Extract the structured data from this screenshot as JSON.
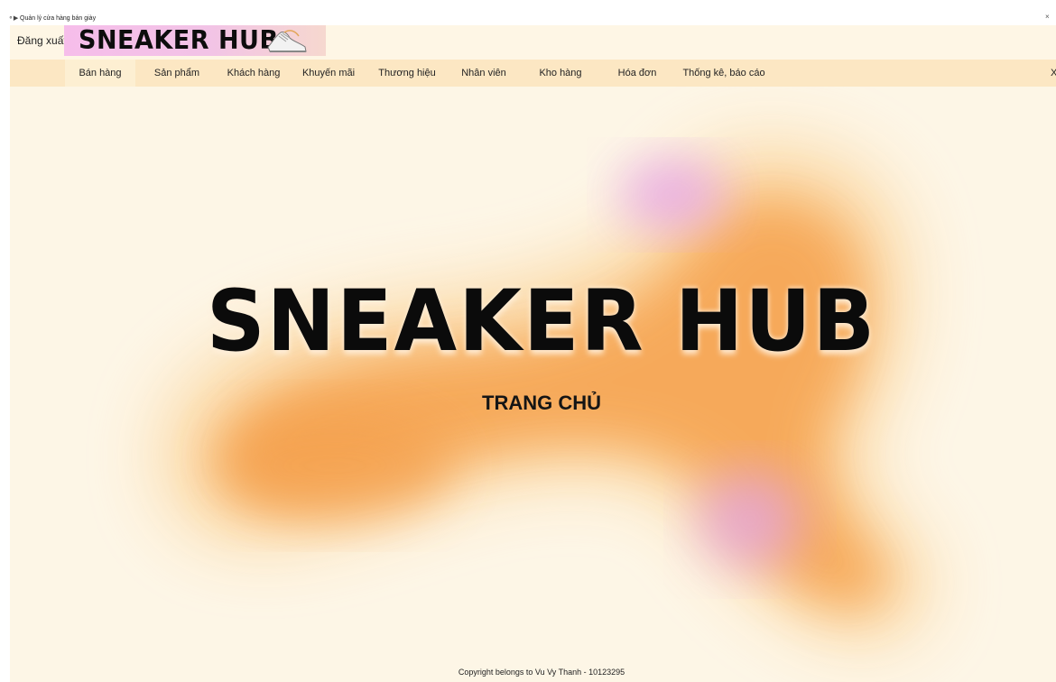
{
  "window": {
    "title": "Quản lý cửa hàng bán giày",
    "icon": "shoe-app-icon"
  },
  "header": {
    "logout_label": "Đăng xuất",
    "logo_text": "SNEAKER HUB",
    "logo_icon": "sneaker-icon"
  },
  "menu": {
    "items": [
      {
        "label": "Bán hàng",
        "active": true
      },
      {
        "label": "Sản phẩm"
      },
      {
        "label": "Khách hàng"
      },
      {
        "label": "Khuyến mãi"
      },
      {
        "label": "Thương hiệu"
      },
      {
        "label": "Nhân viên"
      },
      {
        "label": "Kho hàng"
      },
      {
        "label": "Hóa đơn"
      },
      {
        "label": "Thống kê, báo cáo"
      }
    ],
    "close_label": "X"
  },
  "hero": {
    "title": "SNEAKER HUB",
    "subtitle": "TRANG CHỦ"
  },
  "footer": {
    "copyright": "Copyright belongs to Vu Vy Thanh - 10123295"
  },
  "colors": {
    "background": "#fdf6e6",
    "menu_bar": "#fce7c3",
    "logo_banner": "#f6bdea",
    "blob_orange": "#f5a04a",
    "blob_pink": "#e6a6e0"
  }
}
